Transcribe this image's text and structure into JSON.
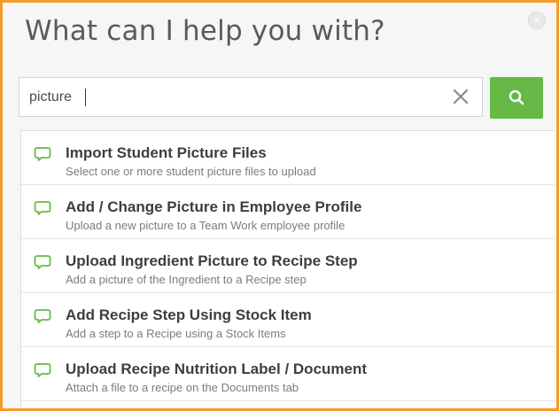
{
  "dialog": {
    "title": "What can I help you with?",
    "close_icon": "close-circle-icon"
  },
  "search": {
    "value": "picture",
    "clear_icon": "x-icon",
    "button_icon": "search-icon",
    "button_color": "#66b946"
  },
  "results": [
    {
      "title": "Import Student Picture Files",
      "description": "Select one or more student picture files to upload",
      "icon": "speech-bubble-icon"
    },
    {
      "title": "Add / Change Picture in Employee Profile",
      "description": "Upload a new picture to a Team Work employee profile",
      "icon": "speech-bubble-icon"
    },
    {
      "title": "Upload Ingredient Picture to Recipe Step",
      "description": "Add a picture of the Ingredient to a Recipe step",
      "icon": "speech-bubble-icon"
    },
    {
      "title": "Add Recipe Step Using Stock Item",
      "description": "Add a step to a Recipe using a Stock Items",
      "icon": "speech-bubble-icon"
    },
    {
      "title": "Upload Recipe Nutrition Label / Document",
      "description": "Attach a file to a recipe on the Documents tab",
      "icon": "speech-bubble-icon"
    }
  ],
  "colors": {
    "border_accent": "#f39a2c",
    "icon_green": "#66b946"
  }
}
